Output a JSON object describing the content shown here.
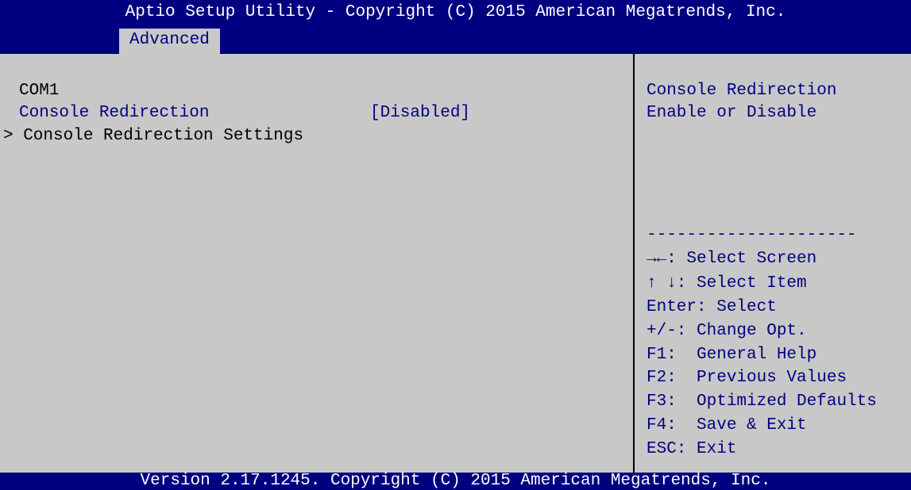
{
  "header": {
    "title": "Aptio Setup Utility - Copyright (C) 2015 American Megatrends, Inc.",
    "active_tab": "Advanced"
  },
  "main": {
    "section_label": "COM1",
    "item": {
      "label": "Console Redirection",
      "value": "[Disabled]"
    },
    "submenu_label": "> Console Redirection Settings"
  },
  "help_panel": {
    "line1": "Console Redirection",
    "line2": "Enable or Disable",
    "separator": "---------------------"
  },
  "key_legend": [
    "→←: Select Screen",
    "↑ ↓: Select Item",
    "Enter: Select",
    "+/-: Change Opt.",
    "F1:  General Help",
    "F2:  Previous Values",
    "F3:  Optimized Defaults",
    "F4:  Save & Exit",
    "ESC: Exit"
  ],
  "footer": {
    "text": "Version 2.17.1245. Copyright (C) 2015 American Megatrends, Inc."
  },
  "colors": {
    "header_bg": "#000080",
    "panel_bg": "#c8c8c8",
    "highlight_text": "#000080",
    "text": "#000000"
  }
}
